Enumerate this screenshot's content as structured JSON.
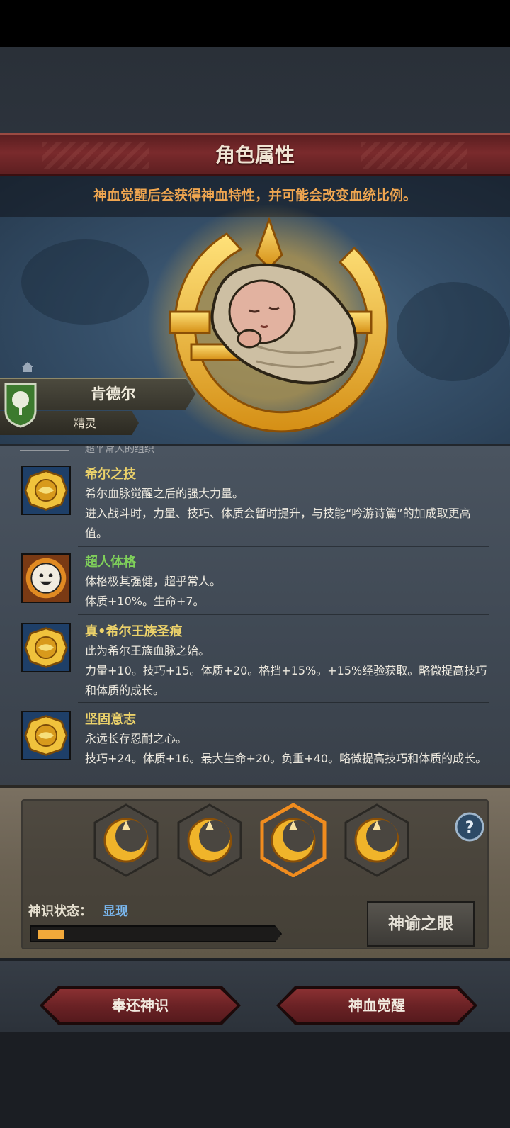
{
  "header": {
    "title": "角色属性"
  },
  "notice": "神血觉醒后会获得神血特性，并可能会改变血统比例。",
  "character": {
    "name": "肯德尔",
    "race": "精灵"
  },
  "traits_cut_text": "超平常人的组织",
  "traits": [
    {
      "name": "希尔之技",
      "name_color": "#ecd26a",
      "icon": "golden-seal-icon",
      "desc": "希尔血脉觉醒之后的强大力量。\n进入战斗时，力量、技巧、体质会暂时提升，与技能“吟游诗篇”的加成取更高值。"
    },
    {
      "name": "超人体格",
      "name_color": "#7fd05a",
      "icon": "smiley-sun-icon",
      "desc": "体格极其强健，超乎常人。\n体质+10%。生命+7。"
    },
    {
      "name": "真•希尔王族圣痕",
      "name_color": "#ecd26a",
      "icon": "golden-seal-icon",
      "desc": "此为希尔王族血脉之始。\n力量+10。技巧+15。体质+20。格挡+15%。+15%经验获取。略微提高技巧和体质的成长。"
    },
    {
      "name": "坚固意志",
      "name_color": "#ecd26a",
      "icon": "golden-seal-icon",
      "desc": "永远长存忍耐之心。\n技巧+24。体质+16。最大生命+20。负重+40。略微提高技巧和体质的成长。"
    }
  ],
  "divine": {
    "slots": [
      {
        "icon": "divine-moon-icon",
        "selected": false
      },
      {
        "icon": "divine-moon-icon",
        "selected": false
      },
      {
        "icon": "divine-moon-icon",
        "selected": true
      },
      {
        "icon": "divine-moon-icon",
        "selected": false
      }
    ],
    "status_label": "神识状态：",
    "status_value": "显现",
    "progress": 0.11,
    "eye_button": "神谕之眼"
  },
  "actions": {
    "return_label": "奉还神识",
    "awaken_label": "神血觉醒"
  },
  "colors": {
    "accent_gold": "#f2b52e",
    "header_red": "#7a2a2c",
    "status_blue": "#7ab8f0"
  }
}
